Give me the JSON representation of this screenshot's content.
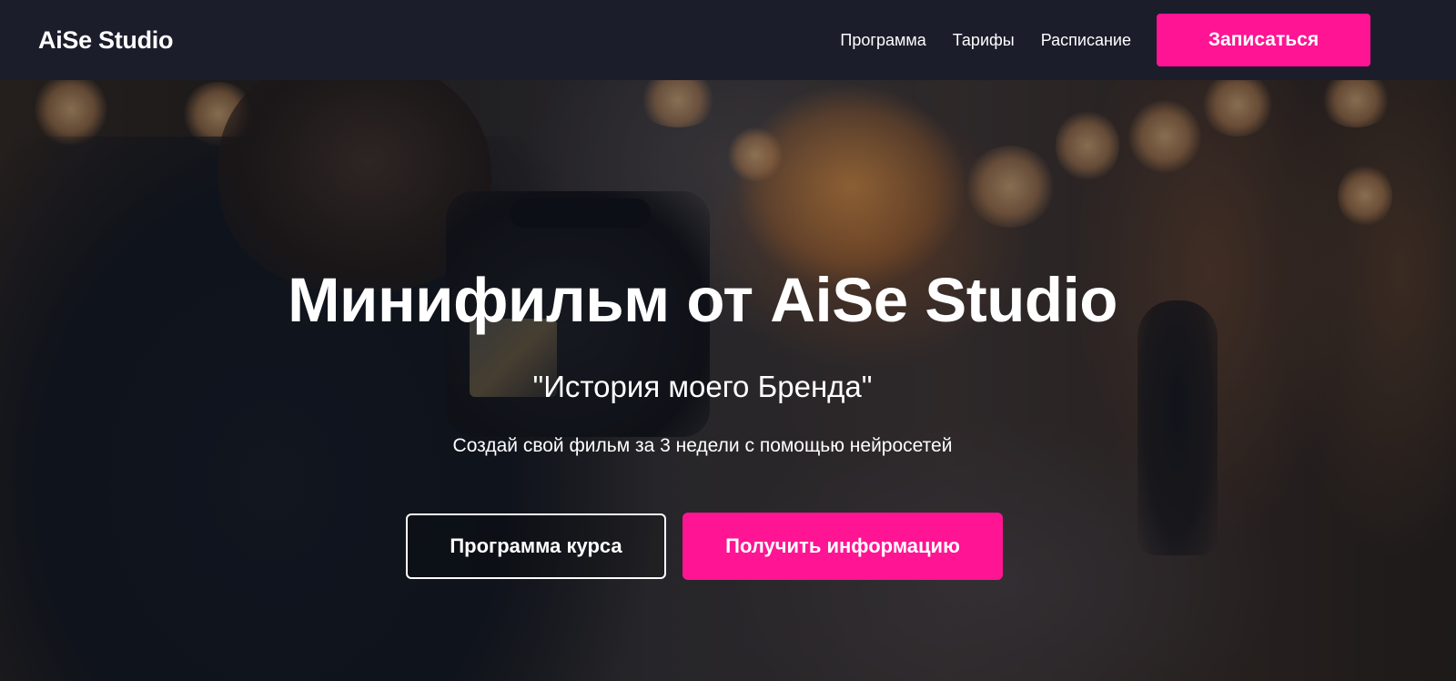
{
  "header": {
    "logo": "AiSe Studio",
    "nav": [
      {
        "label": "Программа"
      },
      {
        "label": "Тарифы"
      },
      {
        "label": "Расписание"
      }
    ],
    "cta_label": "Записаться"
  },
  "hero": {
    "title": "Минифильм от AiSe Studio",
    "subtitle": "\"История моего Бренда\"",
    "description": "Создай свой фильм за 3 недели с помощью нейросетей",
    "secondary_button": "Программа курса",
    "primary_button": "Получить информацию"
  },
  "colors": {
    "accent": "#ff1493",
    "header_bg": "#1b1d2b",
    "text": "#ffffff"
  }
}
